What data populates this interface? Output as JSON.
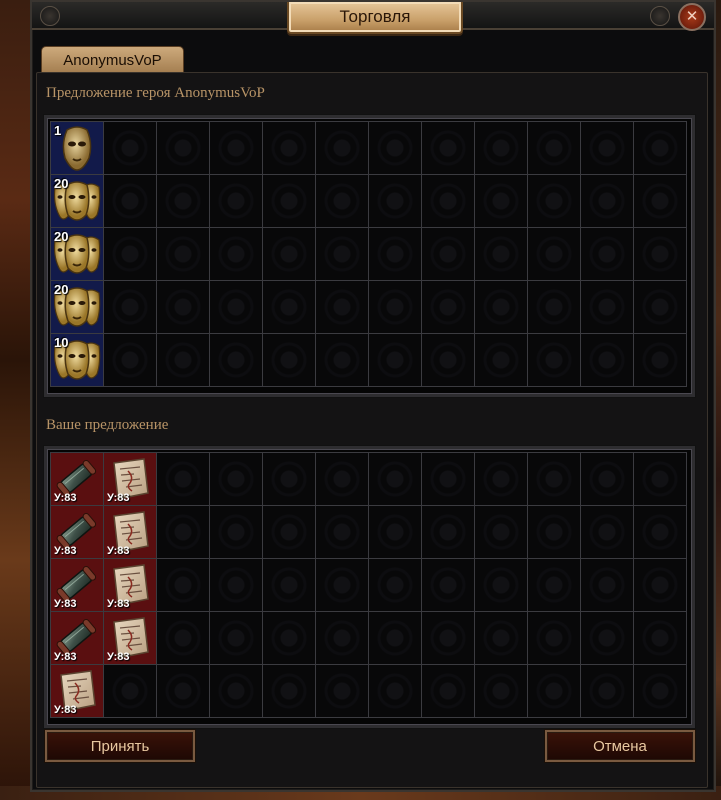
{
  "window": {
    "title": "Торговля",
    "close_icon": "close-icon",
    "tab_label": "AnonymusVoP"
  },
  "hero_offer": {
    "label": "Предложение героя AnonymusVoP",
    "items": [
      {
        "row": 0,
        "col": 0,
        "quantity": "1",
        "icon": "single-mask-icon"
      },
      {
        "row": 1,
        "col": 0,
        "quantity": "20",
        "icon": "triple-mask-icon"
      },
      {
        "row": 2,
        "col": 0,
        "quantity": "20",
        "icon": "triple-mask-icon"
      },
      {
        "row": 3,
        "col": 0,
        "quantity": "20",
        "icon": "triple-mask-icon"
      },
      {
        "row": 4,
        "col": 0,
        "quantity": "10",
        "icon": "triple-mask-icon"
      }
    ]
  },
  "your_offer": {
    "label": "Ваше предложение",
    "items": [
      {
        "row": 0,
        "col": 0,
        "level": "У:83",
        "icon": "scroll-map-icon"
      },
      {
        "row": 0,
        "col": 1,
        "level": "У:83",
        "icon": "parchment-map-icon"
      },
      {
        "row": 1,
        "col": 0,
        "level": "У:83",
        "icon": "scroll-map-icon"
      },
      {
        "row": 1,
        "col": 1,
        "level": "У:83",
        "icon": "parchment-map-icon"
      },
      {
        "row": 2,
        "col": 0,
        "level": "У:83",
        "icon": "scroll-map-icon"
      },
      {
        "row": 2,
        "col": 1,
        "level": "У:83",
        "icon": "parchment-map-icon"
      },
      {
        "row": 3,
        "col": 0,
        "level": "У:83",
        "icon": "scroll-map-icon"
      },
      {
        "row": 3,
        "col": 1,
        "level": "У:83",
        "icon": "parchment-map-icon"
      },
      {
        "row": 4,
        "col": 0,
        "level": "У:83",
        "icon": "parchment-map-icon"
      }
    ]
  },
  "buttons": {
    "accept": "Принять",
    "cancel": "Отмена"
  },
  "colors": {
    "hero_item_bg": "#121a4a",
    "your_item_bg": "#5a0f10",
    "label_gold": "#b89467"
  }
}
